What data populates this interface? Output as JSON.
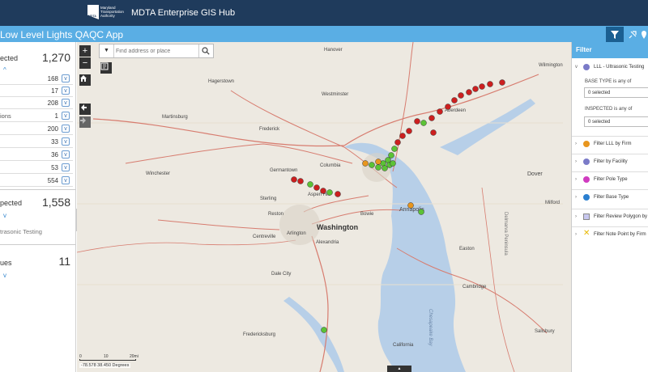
{
  "header": {
    "org_name_lines": [
      "Maryland",
      "Transportation",
      "Authority"
    ],
    "logo_badge": "MDTA",
    "hub_title": "MDTA Enterprise GIS Hub"
  },
  "app": {
    "title": "Low Level Lights QAQC App"
  },
  "left_panel": {
    "stat1": {
      "label": "ected",
      "value": "1,270"
    },
    "rows": [
      {
        "label": "",
        "value": "168"
      },
      {
        "label": "",
        "value": "17"
      },
      {
        "label": "",
        "value": "208"
      },
      {
        "label": "ions",
        "value": "1"
      },
      {
        "label": "",
        "value": "200"
      },
      {
        "label": "",
        "value": "33"
      },
      {
        "label": "",
        "value": "36"
      },
      {
        "label": "",
        "value": "53"
      },
      {
        "label": "",
        "value": "554"
      }
    ],
    "stat2": {
      "label": "pected",
      "value": "1,558"
    },
    "stat2_sub": "trasonic Testing",
    "stat3": {
      "label": "ues",
      "value": "11"
    }
  },
  "search": {
    "placeholder": "Find address or place"
  },
  "map": {
    "coordinates": "-78.578 38.450 Degrees",
    "scale_labels": [
      "0",
      "10",
      "20mi"
    ],
    "labels": [
      {
        "text": "Hanover"
      },
      {
        "text": "Hagerstown"
      },
      {
        "text": "Westminster"
      },
      {
        "text": "Wilmington"
      },
      {
        "text": "Martinsburg"
      },
      {
        "text": "Frederick"
      },
      {
        "text": "Aberdeen"
      },
      {
        "text": "Columbia"
      },
      {
        "text": "Germantown"
      },
      {
        "text": "Winchester"
      },
      {
        "text": "Dover"
      },
      {
        "text": "Sterling"
      },
      {
        "text": "Aspen Hill"
      },
      {
        "text": "Reston"
      },
      {
        "text": "Bowie"
      },
      {
        "text": "Annapolis"
      },
      {
        "text": "Washington"
      },
      {
        "text": "Centreville"
      },
      {
        "text": "Arlington"
      },
      {
        "text": "Alexandria"
      },
      {
        "text": "Dale City"
      },
      {
        "text": "Easton"
      },
      {
        "text": "Fredericksburg"
      },
      {
        "text": "California"
      },
      {
        "text": "Salisbury"
      },
      {
        "text": "Milford"
      },
      {
        "text": "Cambridge"
      },
      {
        "text": "Delmarva Peninsula"
      },
      {
        "text": "Chesapeake Bay"
      }
    ]
  },
  "filter_panel": {
    "title": "Filter",
    "main_item": "LLL - Ultrasonic Testing",
    "base_type_label": "BASE TYPE is any of",
    "base_type_value": "0 selected",
    "inspected_label": "INSPECTED is any of",
    "inspected_value": "0 selected",
    "items": [
      {
        "label": "Filter LLL by Firm",
        "color": "#e8961e"
      },
      {
        "label": "Filter by Facility",
        "color": "#7b7bc8"
      },
      {
        "label": "Filter Pole Type",
        "color": "#d03cc0"
      },
      {
        "label": "Filter Base Type",
        "color": "#2b7fd0"
      },
      {
        "label": "Filter Review Polygon by",
        "color": "#c8c8f0"
      },
      {
        "label": "Filter Note Point by Firm",
        "color": "#e8b800"
      }
    ]
  },
  "colors": {
    "header_bg": "#1f3b5c",
    "appbar_bg": "#5aaee4",
    "red_point": "#cc1f1f",
    "green_point": "#5cc236",
    "orange_point": "#e8961e"
  }
}
